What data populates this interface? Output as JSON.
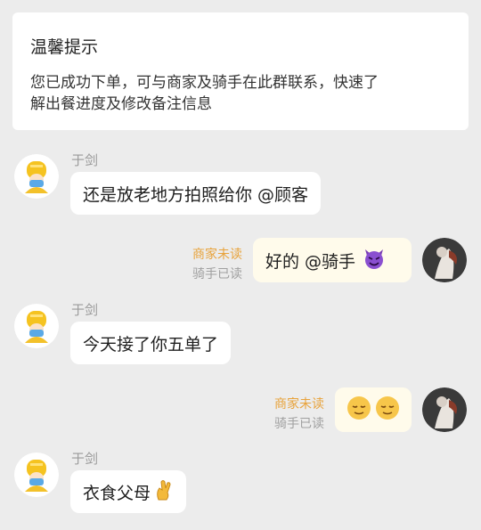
{
  "notice": {
    "title": "温馨提示",
    "line1": "您已成功下单，可与商家及骑手在此群联系，快速了",
    "line2": "解出餐进度及修改备注信息"
  },
  "messages": [
    {
      "sender": "于剑",
      "text": "还是放老地方拍照给你 @顾客"
    },
    {
      "text": "好的 @骑手",
      "status_unread": "商家未读",
      "status_read": "骑手已读",
      "emoji": "smiling-devil-emoji"
    },
    {
      "sender": "于剑",
      "text": "今天接了你五单了"
    },
    {
      "status_unread": "商家未读",
      "status_read": "骑手已读",
      "emoji": "relieved-face-emoji"
    },
    {
      "sender": "于剑",
      "text": "衣食父母",
      "emoji": "crossed-fingers-emoji"
    }
  ],
  "colors": {
    "background": "#ececec",
    "unread": "#e8a33c",
    "read": "#a0a0a0",
    "right_bubble": "#fffbeb"
  }
}
